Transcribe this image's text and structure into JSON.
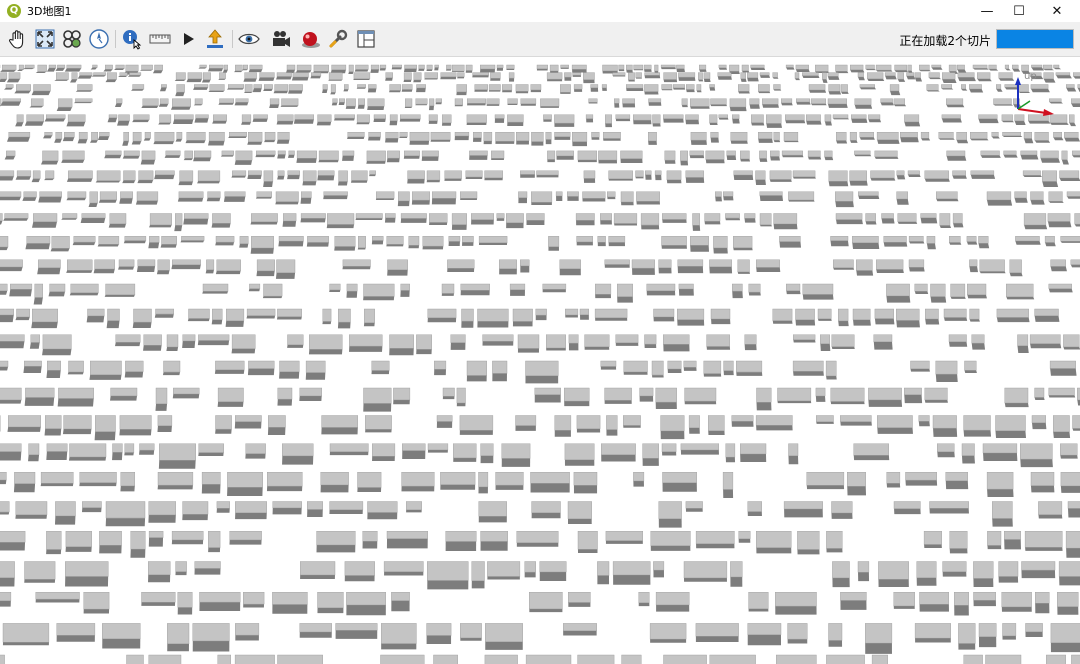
{
  "window": {
    "title": "3D地图1",
    "app_icon_glyph": "Q",
    "controls": {
      "minimize": "—",
      "maximize": "☐",
      "close": "✕"
    }
  },
  "toolbar": {
    "buttons": [
      {
        "id": "pan",
        "icon": "pan-hand-icon"
      },
      {
        "id": "zoom-full",
        "icon": "zoom-full-icon"
      },
      {
        "id": "identify-camera",
        "icon": "camera-control-icon"
      },
      {
        "id": "reset-north",
        "icon": "compass-icon"
      },
      {
        "id": "identify",
        "icon": "identify-icon"
      },
      {
        "id": "measure",
        "icon": "measure-ruler-icon"
      },
      {
        "id": "animations",
        "icon": "play-icon"
      },
      {
        "id": "export",
        "icon": "export-upload-icon"
      },
      {
        "id": "view",
        "icon": "eye-icon"
      },
      {
        "id": "camera",
        "icon": "video-camera-icon"
      },
      {
        "id": "effects",
        "icon": "render-sphere-icon"
      },
      {
        "id": "configure",
        "icon": "wrench-icon"
      },
      {
        "id": "layout",
        "icon": "layout-window-icon"
      }
    ],
    "status_text": "正在加载2个切片",
    "progress_percent": 100
  },
  "viewport": {
    "axis_label": "up",
    "colors": {
      "building": "#c4c4c4",
      "building_side": "#7d7d7d",
      "ground": "#ffffff"
    }
  }
}
